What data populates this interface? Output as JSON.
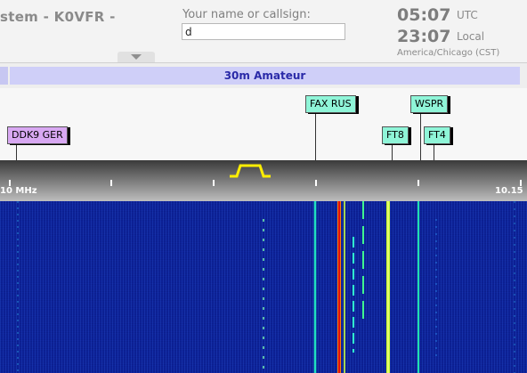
{
  "header": {
    "station_title": "stem - K0VFR -",
    "callsign_label": "Your name or callsign:",
    "callsign_value": "d",
    "utc_time": "05:07",
    "utc_label": "UTC",
    "local_time": "23:07",
    "local_label": "Local",
    "timezone": "America/Chicago (CST)"
  },
  "band": {
    "label": "30m Amateur",
    "color": "#cfcff8"
  },
  "stations": [
    {
      "label": "DDK9 GER",
      "color": "#d8a8f2"
    },
    {
      "label": "FAX RUS",
      "color": "#8ff5d8"
    },
    {
      "label": "WSPR",
      "color": "#8ff5d8"
    },
    {
      "label": "FT8",
      "color": "#8ff5d8"
    },
    {
      "label": "FT4",
      "color": "#8ff5d8"
    }
  ],
  "scale": {
    "left_label": "10 MHz",
    "right_label": "10.15"
  },
  "colors": {
    "waterfall_background": "#0b1f8f",
    "passband_marker": "#ffee00"
  }
}
